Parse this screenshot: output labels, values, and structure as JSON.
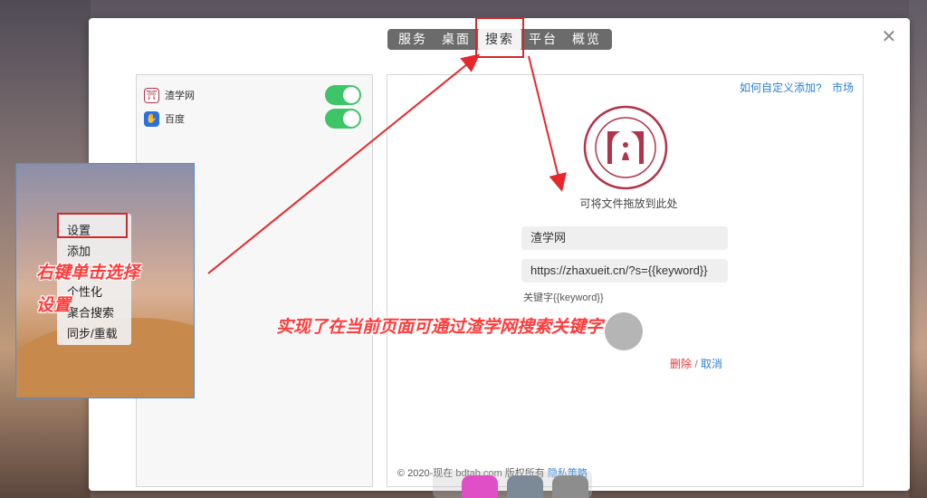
{
  "tabs": [
    {
      "label": "服务",
      "active": false
    },
    {
      "label": "桌面",
      "active": false
    },
    {
      "label": "搜索",
      "active": true
    },
    {
      "label": "平台",
      "active": false
    },
    {
      "label": "概览",
      "active": false
    }
  ],
  "engines": [
    {
      "name": "渣学网",
      "icon": "zhaxue-logo-icon",
      "enabled": true
    },
    {
      "name": "百度",
      "icon": "baidu-paw-icon",
      "enabled": true
    }
  ],
  "help": {
    "custom_link": "如何自定义添加?",
    "market_link": "市场"
  },
  "editor": {
    "drop_hint": "可将文件拖放到此处",
    "name_value": "渣学网",
    "url_value": "https://zhaxueit.cn/?s={{keyword}}",
    "keyword_hint": "关键字{{keyword}}",
    "delete_label": "删除",
    "separator": "/",
    "cancel_label": "取消"
  },
  "footer": {
    "copyright": "© 2020-现在 bdtab.com 版权所有",
    "policy": "隐私策略"
  },
  "context_menu": [
    "设置",
    "添加",
    "个性化",
    "聚合搜索",
    "同步/重载"
  ],
  "annotations": {
    "right_click_1": "右键单击选择",
    "right_click_2": "设置",
    "result": "实现了在当前页面可通过渣学网搜索关键字"
  },
  "colors": {
    "toggle_on": "#3ec567",
    "link": "#2c7fd6",
    "delete": "#e03b3b",
    "annotation": "#ff3b3b"
  }
}
